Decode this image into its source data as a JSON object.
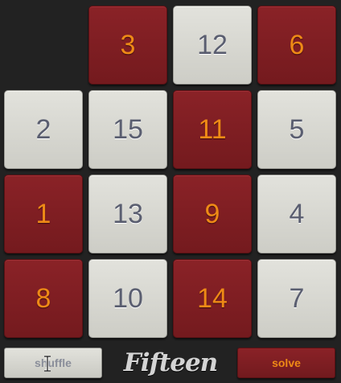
{
  "app": {
    "title": "Fifteen"
  },
  "board": {
    "tiles": [
      {
        "label": "3",
        "style": "dark"
      },
      {
        "label": "12",
        "style": "light"
      },
      {
        "label": "6",
        "style": "dark"
      },
      {
        "label": "2",
        "style": "light"
      },
      {
        "label": "15",
        "style": "light"
      },
      {
        "label": "11",
        "style": "dark"
      },
      {
        "label": "5",
        "style": "light"
      },
      {
        "label": "1",
        "style": "dark"
      },
      {
        "label": "13",
        "style": "light"
      },
      {
        "label": "9",
        "style": "dark"
      },
      {
        "label": "4",
        "style": "light"
      },
      {
        "label": "8",
        "style": "dark"
      },
      {
        "label": "10",
        "style": "light"
      },
      {
        "label": "14",
        "style": "dark"
      },
      {
        "label": "7",
        "style": "light"
      }
    ],
    "empty_cell": "top-left"
  },
  "controls": {
    "shuffle_label": "shuffle",
    "solve_label": "solve"
  },
  "colors": {
    "background": "#222222",
    "light_tile": "#d8d8d2",
    "light_text": "#5a5e70",
    "dark_tile": "#7f1e22",
    "dark_text": "#ee8a16"
  }
}
